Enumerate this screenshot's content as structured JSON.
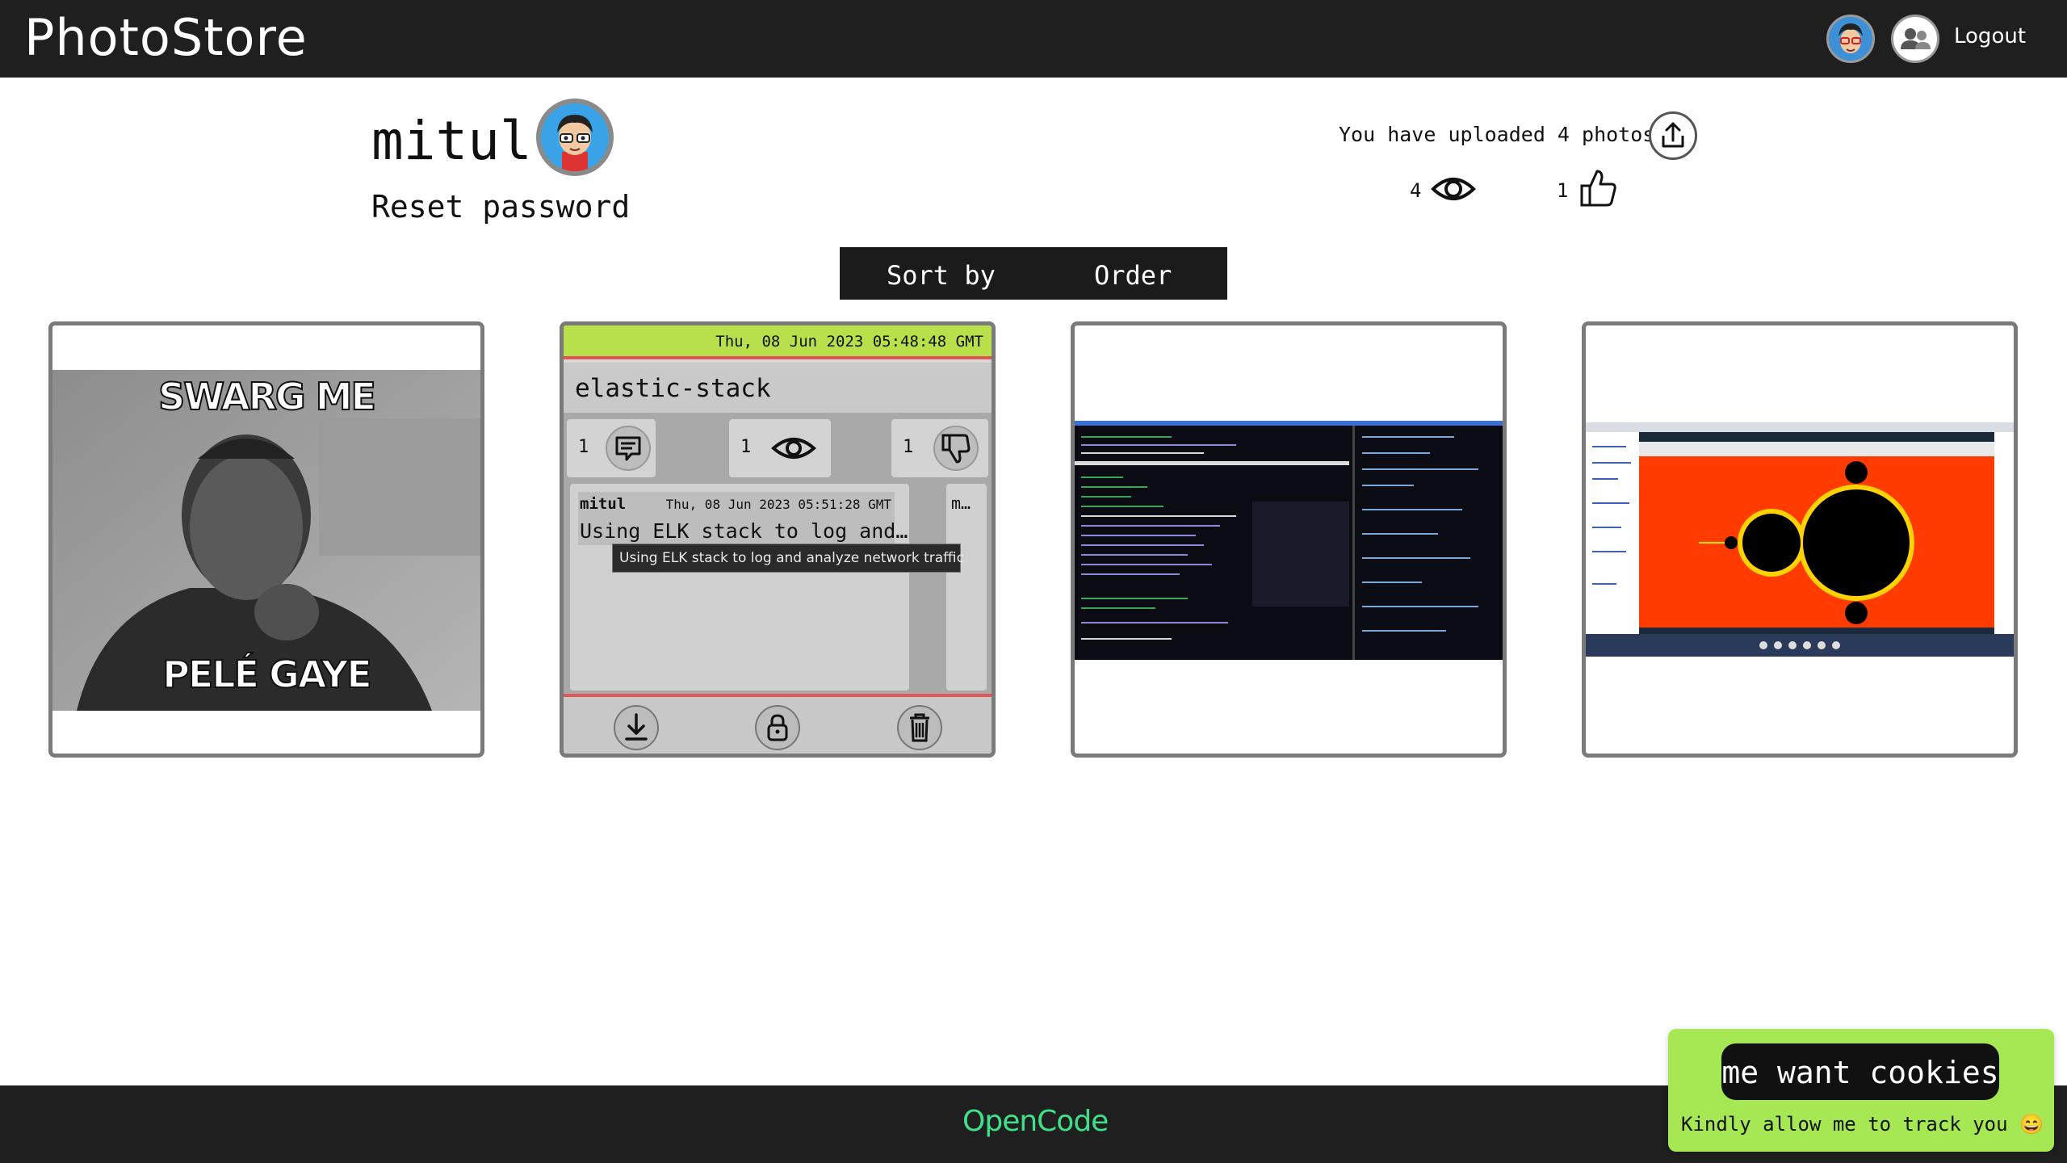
{
  "header": {
    "brand": "PhotoStore",
    "logout_label": "Logout"
  },
  "profile": {
    "username": "mitul",
    "reset_password_label": "Reset password",
    "uploaded_text": "You have uploaded 4 photos",
    "views": "4",
    "likes": "1"
  },
  "sortbar": {
    "sort_label": "Sort by",
    "order_label": "Order"
  },
  "cards": [
    {
      "image_caption_top": "SWARG ME",
      "image_caption_bottom": "PELÉ GAYE"
    },
    {
      "timestamp": "Thu, 08 Jun 2023 05:48:48 GMT",
      "title": "elastic-stack",
      "comments_count": "1",
      "views_count": "1",
      "dislikes_count": "1",
      "comment": {
        "user": "mitul",
        "time": "Thu, 08 Jun 2023 05:51:28 GMT",
        "text": "Using ELK stack to log and…",
        "tooltip": "Using ELK stack to log and analyze network traffic"
      },
      "side_text": "m…"
    },
    {},
    {}
  ],
  "footer": {
    "logo": "OpenCode"
  },
  "cookie": {
    "button_label": "me want cookies",
    "message": "Kindly allow me to track you 😄"
  },
  "colors": {
    "header_bg": "#1f1f1f",
    "timestamp_bar": "#b8e04a",
    "accent_red": "#e05555",
    "cookie_bg": "#a5e853",
    "footer_logo": "#3fe08a"
  }
}
